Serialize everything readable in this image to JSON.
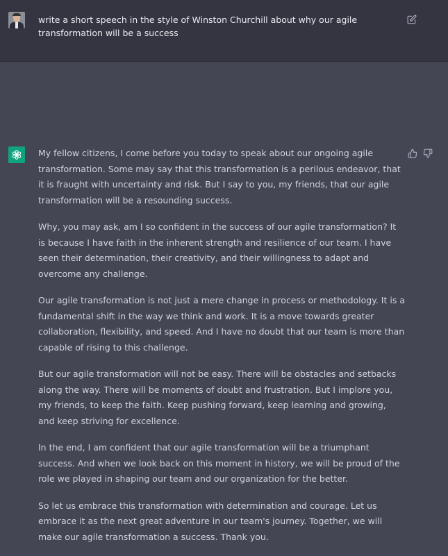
{
  "prompt": {
    "text": "write a short speech in the style of Winston Churchill about why our agile transformation will be a success"
  },
  "response": {
    "paragraphs": [
      "My fellow citizens, I come before you today to speak about our ongoing agile transformation. Some may say that this transformation is a perilous endeavor, that it is fraught with uncertainty and risk. But I say to you, my friends, that our agile transformation will be a resounding success.",
      "Why, you may ask, am I so confident in the success of our agile transformation? It is because I have faith in the inherent strength and resilience of our team. I have seen their determination, their creativity, and their willingness to adapt and overcome any challenge.",
      "Our agile transformation is not just a mere change in process or methodology. It is a fundamental shift in the way we think and work. It is a move towards greater collaboration, flexibility, and speed. And I have no doubt that our team is more than capable of rising to this challenge.",
      "But our agile transformation will not be easy. There will be obstacles and setbacks along the way. There will be moments of doubt and frustration. But I implore you, my friends, to keep the faith. Keep pushing forward, keep learning and growing, and keep striving for excellence.",
      "In the end, I am confident that our agile transformation will be a triumphant success. And when we look back on this moment in history, we will be proud of the role we played in shaping our team and our organization for the better.",
      "So let us embrace this transformation with determination and courage. Let us embrace it as the next great adventure in our team's journey. Together, we will make our agile transformation a success. Thank you."
    ]
  },
  "icons": {
    "user_avatar": "user-photo-avatar",
    "bot_avatar": "openai-logo",
    "edit": "edit-icon",
    "thumbs_up": "thumbs-up-icon",
    "thumbs_down": "thumbs-down-icon"
  },
  "colors": {
    "user_bg": "#343541",
    "assistant_bg": "#444654",
    "bot_avatar_bg": "#10a37f",
    "text": "#d1d5db"
  }
}
